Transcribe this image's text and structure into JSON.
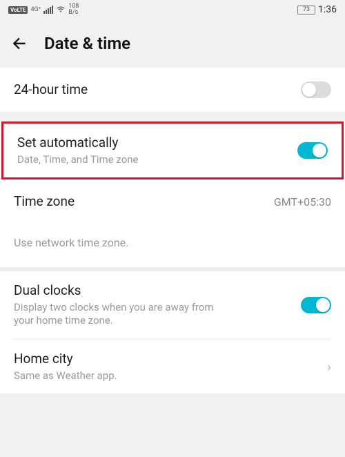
{
  "status": {
    "volte": "VoLTE",
    "net_gen": "4G⁺",
    "speed_top": "108",
    "speed_bot": "B/s",
    "battery_pct": "73",
    "time": "1:36"
  },
  "header": {
    "title": "Date & time"
  },
  "rows": {
    "hour24": {
      "title": "24-hour time",
      "on": false
    },
    "auto": {
      "title": "Set automatically",
      "sub": "Date, Time, and Time zone",
      "on": true
    },
    "timezone": {
      "title": "Time zone",
      "value": "GMT+05:30"
    },
    "hint": "Use network time zone.",
    "dual": {
      "title": "Dual clocks",
      "sub": "Display two clocks when you are away from your home time zone.",
      "on": true
    },
    "home": {
      "title": "Home city",
      "sub": "Same as Weather app."
    }
  }
}
